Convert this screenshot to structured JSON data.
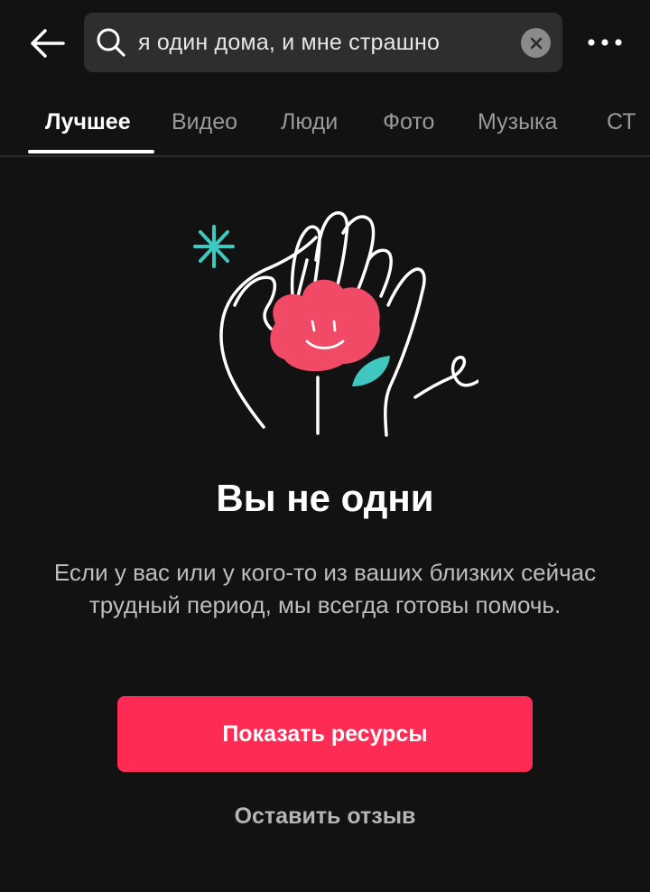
{
  "header": {
    "search": {
      "query": "я один дома, и мне страшно"
    }
  },
  "tabs": [
    {
      "label": "Лучшее",
      "active": true
    },
    {
      "label": "Видео",
      "active": false
    },
    {
      "label": "Люди",
      "active": false
    },
    {
      "label": "Фото",
      "active": false
    },
    {
      "label": "Музыка",
      "active": false
    },
    {
      "label": "СТ",
      "active": false
    }
  ],
  "support": {
    "title": "Вы не одни",
    "description": "Если у вас или у кого-то из ваших близких сейчас трудный период, мы всегда готовы помочь.",
    "primary_button": "Показать ресурсы",
    "feedback_link": "Оставить отзыв"
  },
  "icons": {
    "back": "arrow-left-icon",
    "search": "search-icon",
    "clear": "close-circle-icon",
    "more": "more-horizontal-icon",
    "illustration": "hands-holding-heart-illustration"
  },
  "colors": {
    "background": "#121212",
    "accent": "#fe2c55",
    "search_bg": "#2e2e2e",
    "teal": "#3ec8c0"
  }
}
